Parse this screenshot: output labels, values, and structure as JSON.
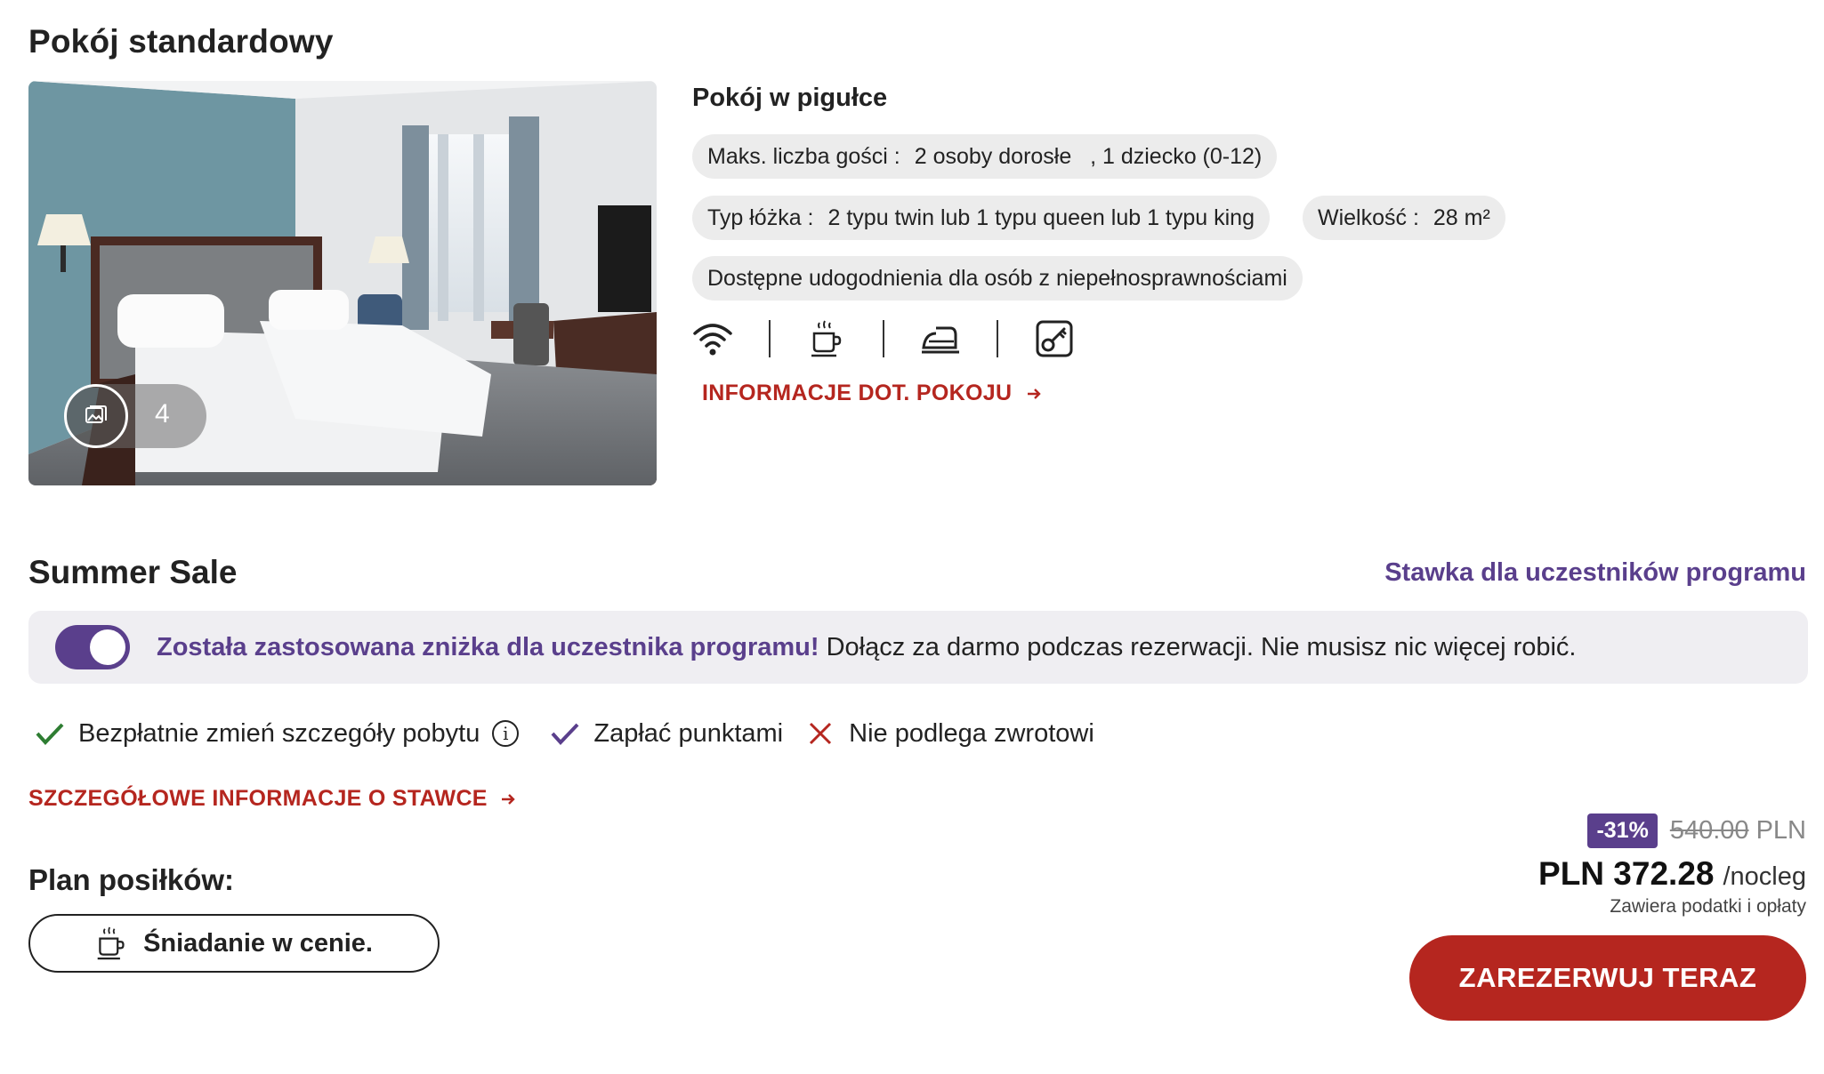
{
  "room": {
    "title": "Pokój standardowy",
    "photo_count": "4",
    "summary_title": "Pokój w pigułce",
    "max_guests_label": "Maks. liczba gości :",
    "max_guests_value": "2 osoby dorosłe   , 1 dziecko (0-12)",
    "bed_label": "Typ łóżka :",
    "bed_value": "2 typu twin lub 1 typu queen lub 1 typu king",
    "size_label": "Wielkość :",
    "size_value": "28 m²",
    "accessibility": "Dostępne udogodnienia dla osób z niepełnosprawnościami",
    "amenities": [
      "wifi-icon",
      "coffee-icon",
      "iron-icon",
      "key-card-icon"
    ],
    "info_link": "INFORMACJE DOT. POKOJU"
  },
  "rate": {
    "title": "Summer Sale",
    "member_rate_label": "Stawka dla uczestników programu",
    "banner_strong": "Została zastosowana zniżka dla uczestnika programu!",
    "banner_text": " Dołącz za darmo podczas rezerwacji. Nie musisz nic więcej robić.",
    "features": {
      "change": "Bezpłatnie zmień szczegóły pobytu",
      "points": "Zapłać punktami",
      "refund": "Nie podlega zwrotowi"
    },
    "details_link": "SZCZEGÓŁOWE INFORMACJE O STAWCE",
    "meal_title": "Plan posiłków:",
    "meal_option": "Śniadanie w cenie."
  },
  "price": {
    "discount": "-31%",
    "old_price": "540.00",
    "old_currency": " PLN",
    "current": "PLN 372.28",
    "unit": "/nocleg",
    "note": "Zawiera podatki i opłaty",
    "book_label": "ZAREZERWUJ TERAZ"
  },
  "colors": {
    "accent_red": "#b5261f",
    "member_purple": "#5a3f8c",
    "check_green": "#2e7d32"
  }
}
